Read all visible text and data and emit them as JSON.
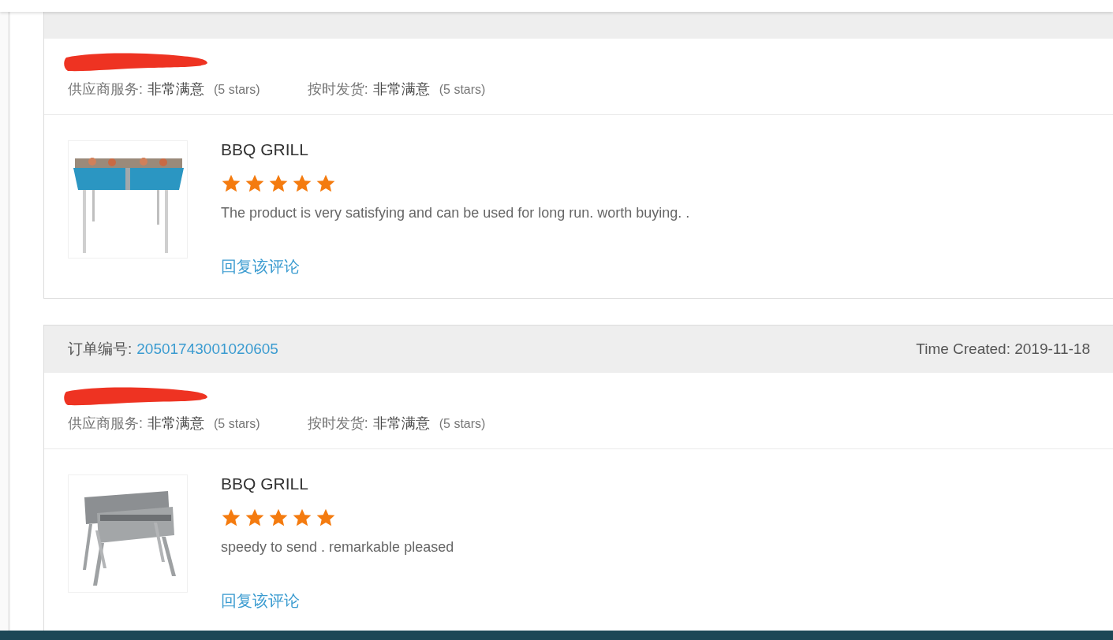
{
  "orders": [
    {
      "redacted": true,
      "ratings": [
        {
          "label": "供应商服务:",
          "value": "非常满意",
          "note": "(5 stars)"
        },
        {
          "label": "按时发货:",
          "value": "非常满意",
          "note": "(5 stars)"
        }
      ],
      "product": {
        "title": "BBQ GRILL",
        "stars": 5,
        "comment": "The product is very satisfying and can be used for long run. worth buying. .",
        "reply_link": "回复该评论"
      }
    },
    {
      "order_label": "订单编号:",
      "order_number": "20501743001020605",
      "time_created": "Time Created: 2019-11-18",
      "redacted": true,
      "ratings": [
        {
          "label": "供应商服务:",
          "value": "非常满意",
          "note": "(5 stars)"
        },
        {
          "label": "按时发货:",
          "value": "非常满意",
          "note": "(5 stars)"
        }
      ],
      "product": {
        "title": "BBQ GRILL",
        "stars": 5,
        "comment": "speedy to send . remarkable pleased",
        "reply_link": "回复该评论"
      }
    }
  ]
}
